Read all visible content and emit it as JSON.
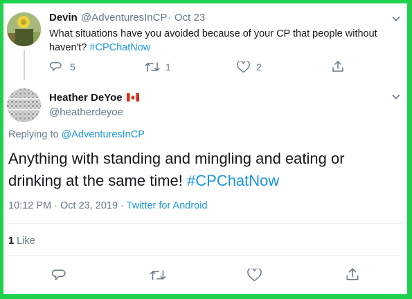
{
  "parent_tweet": {
    "author_name": "Devin",
    "author_handle": "@AdventuresInCP",
    "separator": "·",
    "date": "Oct 23",
    "text_line1": "What situations have you avoided because of your CP that people without",
    "text_line2_plain": "haven't? ",
    "hashtag": "#CPChatNow",
    "reply_count": "5",
    "retweet_count": "1",
    "like_count": "2",
    "icons": {
      "reply": "reply-icon",
      "retweet": "retweet-icon",
      "like": "heart-icon",
      "share": "share-icon",
      "menu": "chevron-down-icon"
    }
  },
  "main_tweet": {
    "author_name": "Heather DeYoe",
    "author_flag": "🇨🇦",
    "author_handle": "@heatherdeyoe",
    "replying_prefix": "Replying to ",
    "replying_to": "@AdventuresInCP",
    "text_line1": "Anything with standing and mingling and eating or",
    "text_line2_plain": "drinking at the same time! ",
    "hashtag": "#CPChatNow",
    "time": "10:12 PM",
    "separator": "·",
    "date": "Oct 23, 2019",
    "source": "Twitter for Android",
    "like_count": "1",
    "like_label": "Like",
    "icons": {
      "reply": "reply-icon",
      "retweet": "retweet-icon",
      "like": "heart-icon",
      "share": "share-icon",
      "menu": "chevron-down-icon",
      "flag": "canada-flag-icon"
    }
  },
  "colors": {
    "border": "#1fd14d",
    "link": "#1b95e0",
    "text": "#14171a",
    "secondary": "#657786"
  }
}
